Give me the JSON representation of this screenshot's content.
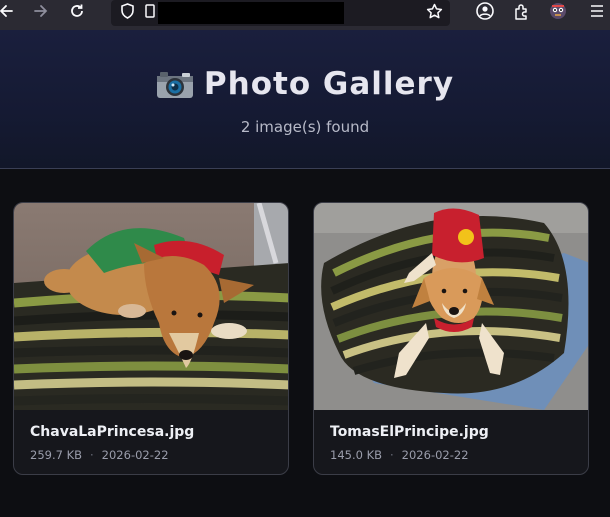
{
  "browser": {
    "url_redacted": true,
    "icons": [
      "back-icon",
      "forward-icon",
      "reload-icon",
      "shield-icon",
      "page-icon",
      "bookmark-star-icon",
      "account-icon",
      "extensions-icon",
      "extension-avatar-icon",
      "menu-icon"
    ]
  },
  "header": {
    "title_icon": "camera-icon",
    "title": "Photo Gallery",
    "subtitle": "2 image(s) found"
  },
  "gallery": [
    {
      "filename": "ChavaLaPrincesa.jpg",
      "size": "259.7 KB",
      "separator": "·",
      "date": "2026-02-22"
    },
    {
      "filename": "TomasElPrincipe.jpg",
      "size": "145.0 KB",
      "separator": "·",
      "date": "2026-02-22"
    }
  ],
  "colors": {
    "page_background": "#0d0e12",
    "header_background": "#1a1f3d",
    "card_background": "#16171c",
    "card_border": "#3b3d47",
    "toolbar_background": "#2b2a33"
  }
}
